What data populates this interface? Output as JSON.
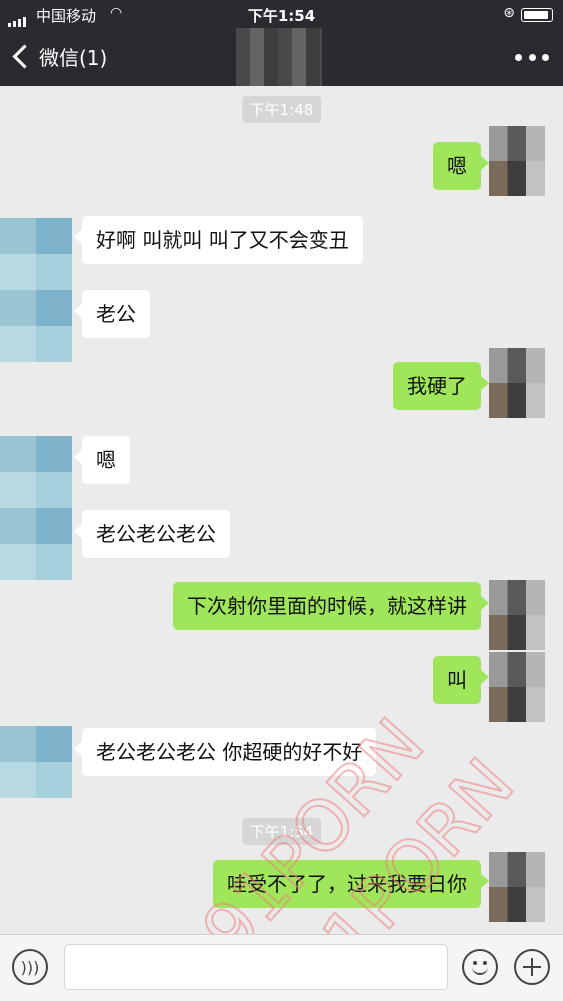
{
  "status_bar": {
    "carrier": "中国移动",
    "time": "下午1:54"
  },
  "nav": {
    "back_label": "微信(1)"
  },
  "messages": [
    {
      "type": "timestamp",
      "text": "下午1:48"
    },
    {
      "type": "right",
      "text": "嗯"
    },
    {
      "type": "left",
      "text": "好啊 叫就叫 叫了又不会变丑"
    },
    {
      "type": "left",
      "text": "老公"
    },
    {
      "type": "right",
      "text": "我硬了"
    },
    {
      "type": "left",
      "text": "嗯"
    },
    {
      "type": "left",
      "text": "老公老公老公"
    },
    {
      "type": "right",
      "text": "下次射你里面的时候，就这样讲"
    },
    {
      "type": "right",
      "text": "叫"
    },
    {
      "type": "left",
      "text": "老公老公老公 你超硬的好不好"
    },
    {
      "type": "timestamp",
      "text": "下午1:54"
    },
    {
      "type": "right",
      "text": "哇受不了了，过来我要日你"
    }
  ],
  "input": {
    "value": ""
  },
  "watermark": {
    "text_1": "91PORN",
    "text_2": "91PORN",
    "color": "#f08080"
  },
  "colors": {
    "nav_bg": "#2b2a30",
    "chat_bg": "#ebebeb",
    "self_bubble": "#9fe65a",
    "other_bubble": "#ffffff"
  }
}
